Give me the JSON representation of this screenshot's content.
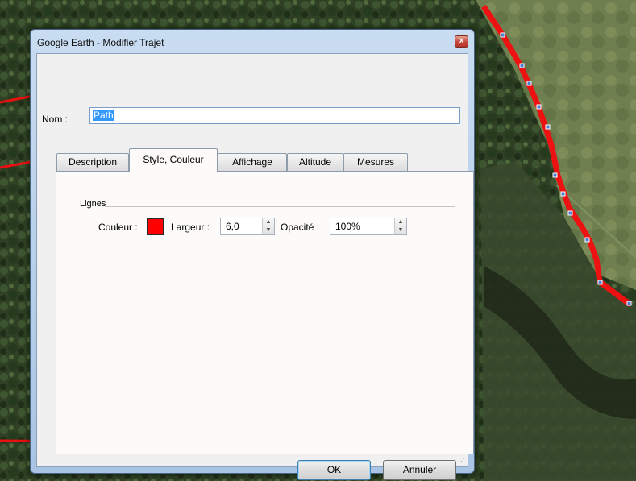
{
  "window": {
    "title": "Google Earth - Modifier Trajet",
    "close_glyph": "x"
  },
  "name_field": {
    "label": "Nom :",
    "value": "Path"
  },
  "tabs": [
    {
      "label": "Description",
      "active": false
    },
    {
      "label": "Style, Couleur",
      "active": true
    },
    {
      "label": "Affichage",
      "active": false
    },
    {
      "label": "Altitude",
      "active": false
    },
    {
      "label": "Mesures",
      "active": false
    }
  ],
  "style_panel": {
    "group_label": "Lignes",
    "color_label": "Couleur :",
    "line_color": "#ff0000",
    "width_label": "Largeur :",
    "width_value": "6,0",
    "opacity_label": "Opacité :",
    "opacity_value": "100%"
  },
  "buttons": {
    "ok": "OK",
    "cancel": "Annuler"
  },
  "icons": {
    "close": "close-icon",
    "spin_up": "spin-up-icon",
    "spin_down": "spin-down-icon",
    "annotation_arrow": "red-arrow-icon"
  },
  "colors": {
    "track_line": "#ee1111",
    "annotation_arrow": "#e81010",
    "selection": "#3399ff"
  }
}
